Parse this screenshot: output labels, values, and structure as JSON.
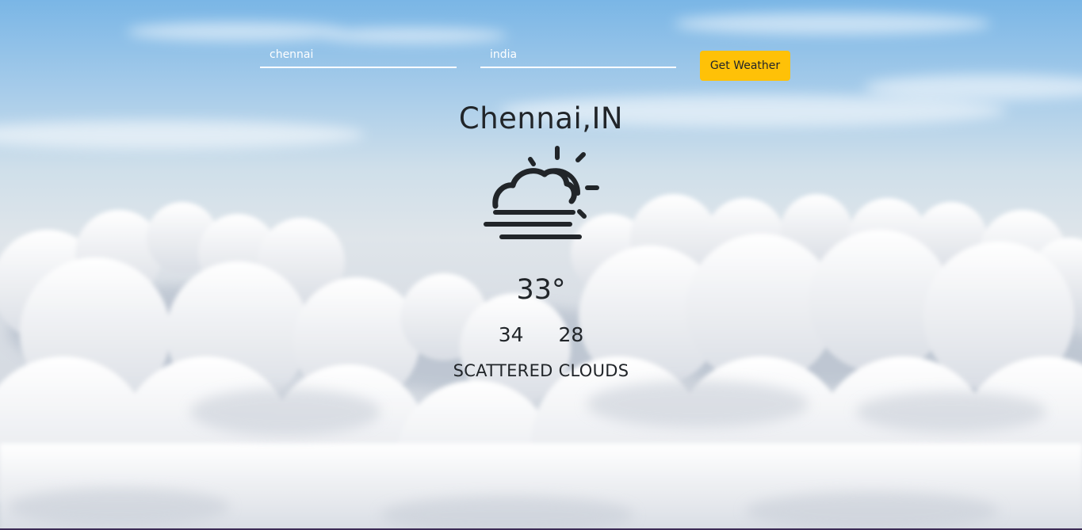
{
  "form": {
    "city_value": "chennai",
    "country_value": "india",
    "submit_label": "Get Weather"
  },
  "result": {
    "location": "Chennai,IN",
    "icon": "sun-behind-cloud-fog-icon",
    "temperature": "33°",
    "temp_max": "34",
    "temp_min": "28",
    "description": "SCATTERED CLOUDS"
  },
  "colors": {
    "accent": "#ffc107",
    "text": "#212529",
    "input_text": "#ffffff"
  }
}
